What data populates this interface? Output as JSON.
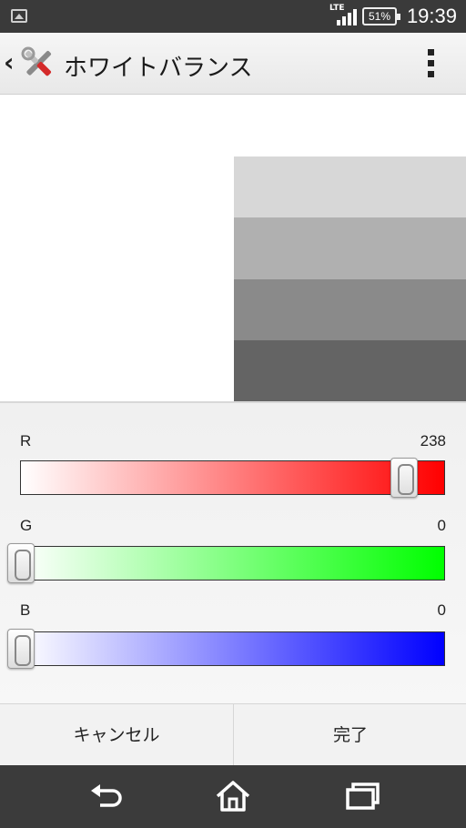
{
  "status_bar": {
    "network": "LTE",
    "battery": "51%",
    "time": "19:39"
  },
  "action_bar": {
    "back_icon": "back-chevron-icon",
    "app_icon": "tools-icon",
    "title": "ホワイトバランス",
    "menu_icon": "overflow-menu-icon"
  },
  "preview": {
    "swatches": [
      "#d7d7d7",
      "#b0b0b0",
      "#8a8a8a",
      "#646464"
    ]
  },
  "sliders": [
    {
      "label": "R",
      "value": "238",
      "level": 0.933,
      "color": "#ff0000"
    },
    {
      "label": "G",
      "value": "0",
      "level": 0.0,
      "color": "#00ff00"
    },
    {
      "label": "B",
      "value": "0",
      "level": 0.0,
      "color": "#0000ff"
    }
  ],
  "buttons": {
    "cancel": "キャンセル",
    "done": "完了"
  },
  "nav_bar": {
    "back": "back-icon",
    "home": "home-icon",
    "recents": "recents-icon"
  }
}
